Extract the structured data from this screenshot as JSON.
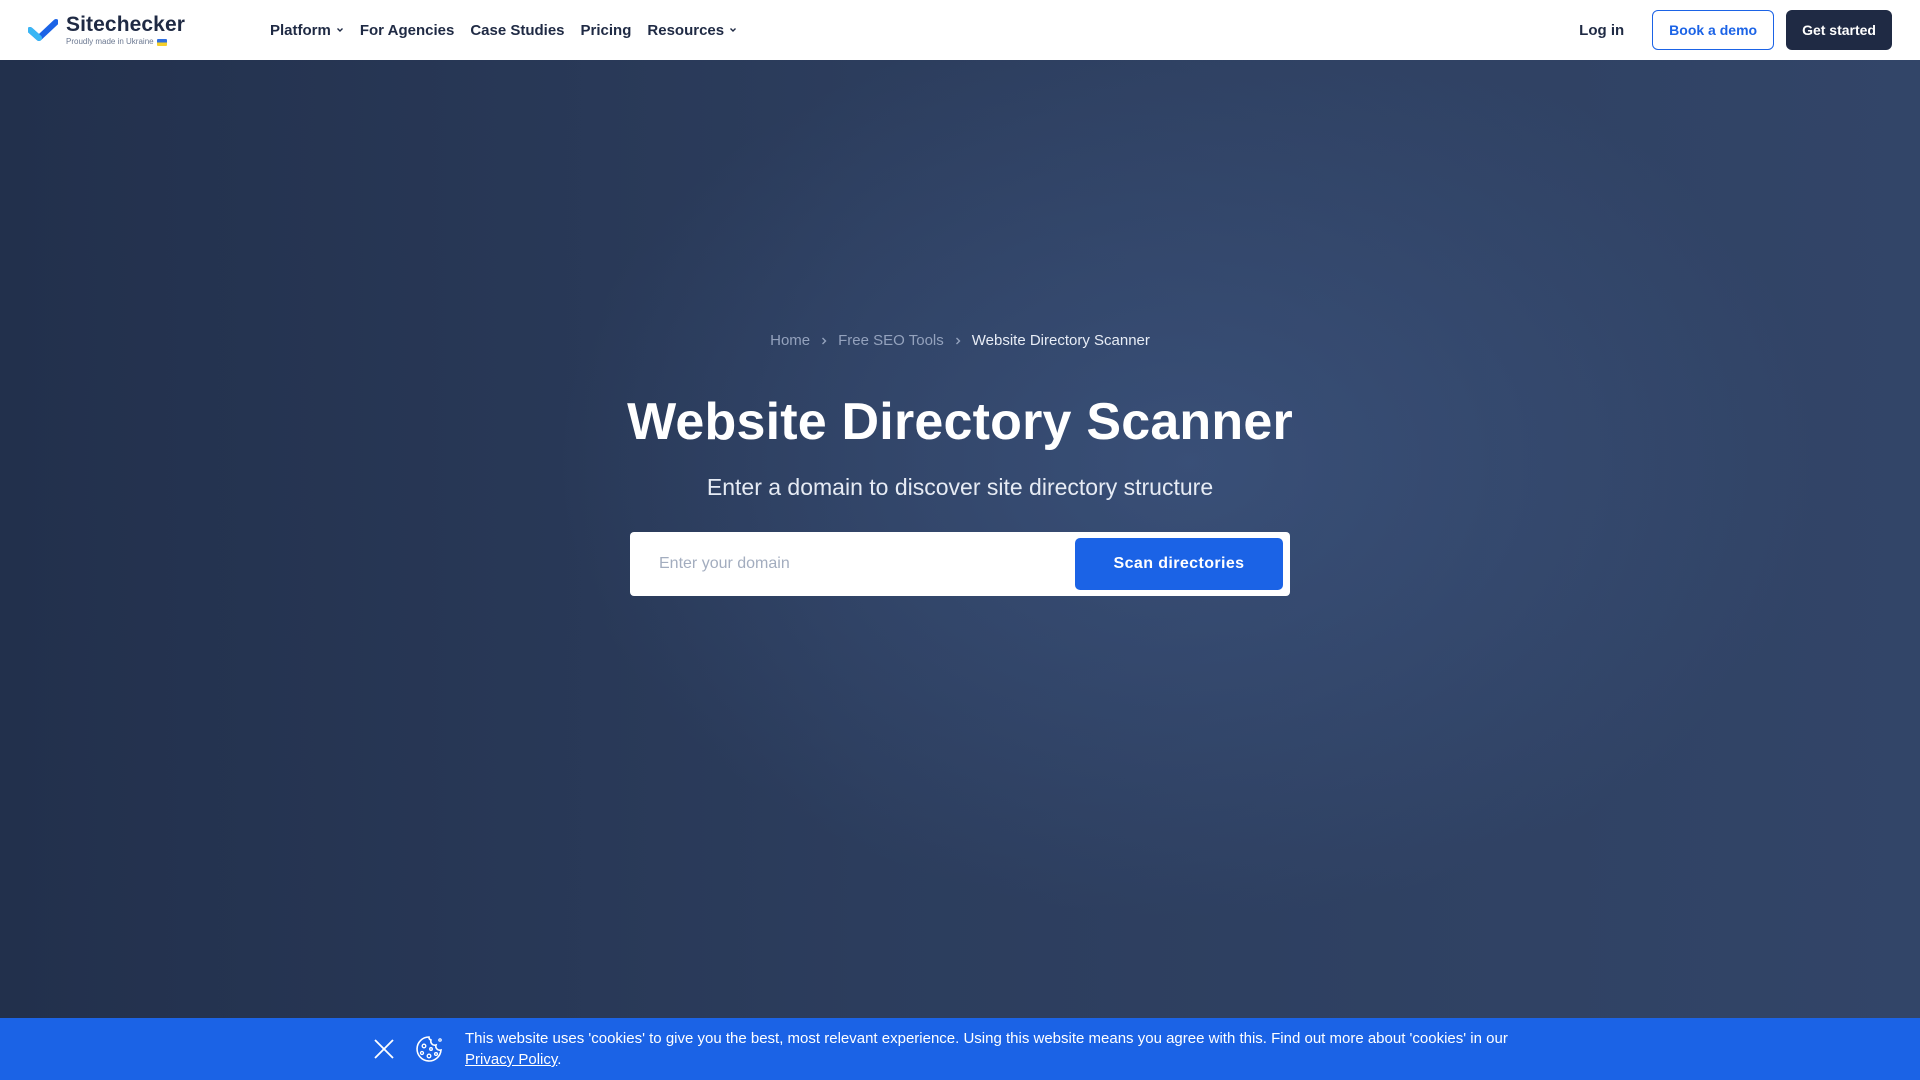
{
  "colors": {
    "brand_blue": "#1b63e6",
    "navy": "#1f2a44",
    "hero_bg": "#2c3d5d",
    "cookie_bg": "#1b63e6"
  },
  "header": {
    "logo": {
      "name": "Sitechecker",
      "tagline": "Proudly made in Ukraine",
      "icon": "checkmark-logo-icon"
    },
    "nav": [
      {
        "label": "Platform",
        "has_dropdown": true
      },
      {
        "label": "For Agencies",
        "has_dropdown": false
      },
      {
        "label": "Case Studies",
        "has_dropdown": false
      },
      {
        "label": "Pricing",
        "has_dropdown": false
      },
      {
        "label": "Resources",
        "has_dropdown": true
      }
    ],
    "login_label": "Log in",
    "demo_label": "Book a demo",
    "start_label": "Get started"
  },
  "hero": {
    "breadcrumb": {
      "home": "Home",
      "tools": "Free SEO Tools",
      "current": "Website Directory Scanner"
    },
    "title": "Website Directory Scanner",
    "subtitle": "Enter a domain to discover site directory structure",
    "search": {
      "placeholder": "Enter your domain",
      "value": "",
      "button_label": "Scan directories"
    }
  },
  "cookie": {
    "text": "This website uses 'cookies' to give you the best, most relevant experience. Using this website means you agree with this. Find out more about 'cookies' in our ",
    "link_label": "Privacy Policy",
    "end": ".",
    "close_icon": "close-icon",
    "cookie_icon": "cookie-icon"
  }
}
